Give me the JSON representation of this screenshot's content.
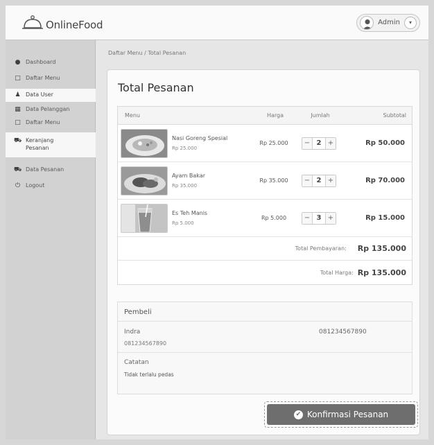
{
  "brand": {
    "name": "OnlineFood"
  },
  "user": {
    "name": "Admin",
    "caret": "▾"
  },
  "sidebar": {
    "items": [
      {
        "label": "Dashboard",
        "icon": "●"
      },
      {
        "label": "Daftar Menu",
        "icon": "□"
      },
      {
        "label": "Data User",
        "icon": "♟"
      },
      {
        "label": "Data Pelanggan",
        "icon": "▦"
      },
      {
        "label": "Daftar Menu",
        "icon": "□"
      },
      {
        "label": "Keranjang Pesanan",
        "icon": "⛟"
      },
      {
        "label": "Data Pesanan",
        "icon": "⛟"
      },
      {
        "label": "Logout",
        "icon": "⏻"
      }
    ]
  },
  "breadcrumb": "Daftar Menu / Total Pesanan",
  "page": {
    "title": "Total Pesanan"
  },
  "table": {
    "headers": {
      "menu": "Menu",
      "harga": "Harga",
      "jumlah": "Jumlah",
      "subtotal": "Subtotal"
    },
    "rows": [
      {
        "name": "Nasi Goreng Spesial",
        "price_small": "Rp 25.000",
        "harga": "Rp 25.000",
        "qty": "2",
        "subtotal": "Rp 50.000",
        "thumb_icon": "fried-rice-photo"
      },
      {
        "name": "Ayam Bakar",
        "price_small": "Rp 35.000",
        "harga": "Rp 35.000",
        "qty": "2",
        "subtotal": "Rp 70.000",
        "thumb_icon": "grilled-chicken-photo"
      },
      {
        "name": "Es Teh Manis",
        "price_small": "Rp 5.000",
        "harga": "Rp 5.000",
        "qty": "3",
        "subtotal": "Rp 15.000",
        "thumb_icon": "iced-tea-photo"
      }
    ],
    "minus": "−",
    "plus": "+",
    "total_pembayaran_label": "Total Pembayaran:",
    "total_pembayaran_value": "Rp 135.000",
    "total_harga_label": "Total Harga:",
    "total_harga_value": "Rp 135.000"
  },
  "buyer": {
    "heading": "Pembeli",
    "name": "Indra",
    "phone": "081234567890",
    "phone_right": "081234567890",
    "note_label": "Catatan",
    "note": "Tidak terlalu pedas"
  },
  "confirm_button": {
    "label": "Konfirmasi Pesanan",
    "icon": "✔"
  }
}
